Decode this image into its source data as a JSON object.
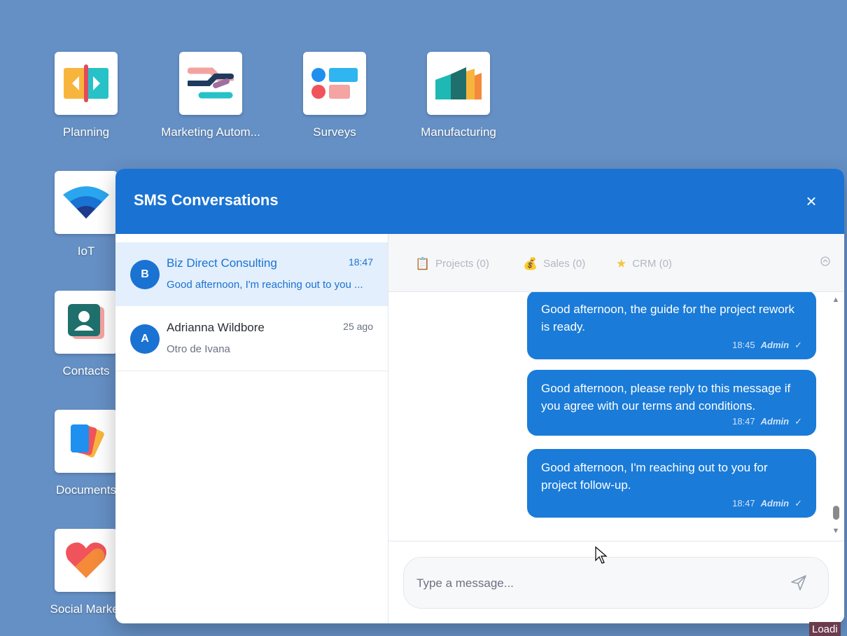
{
  "apps": [
    {
      "label": "Planning",
      "icon": "planning-icon"
    },
    {
      "label": "Marketing Autom...",
      "icon": "marketing-automation-icon"
    },
    {
      "label": "Surveys",
      "icon": "surveys-icon"
    },
    {
      "label": "Manufacturing",
      "icon": "manufacturing-icon"
    },
    {
      "label": "IoT",
      "icon": "iot-icon"
    },
    {
      "label": "Contacts",
      "icon": "contacts-icon"
    },
    {
      "label": "Documents",
      "icon": "documents-icon"
    },
    {
      "label": "Social Market",
      "icon": "social-marketing-icon"
    }
  ],
  "modal": {
    "title": "SMS Conversations",
    "close": "×"
  },
  "conversations": [
    {
      "avatar": "B",
      "name": "Biz Direct Consulting",
      "time": "18:47",
      "preview": "Good afternoon, I'm reaching out to you ...",
      "active": true
    },
    {
      "avatar": "A",
      "name": "Adrianna Wildbore",
      "time": "25 ago",
      "preview": "Otro de Ivana",
      "active": false
    }
  ],
  "tabs": [
    {
      "label": "Projects (0)",
      "icon": "clipboard-icon"
    },
    {
      "label": "Sales (0)",
      "icon": "money-bag-icon"
    },
    {
      "label": "CRM (0)",
      "icon": "star-icon"
    }
  ],
  "messages": [
    {
      "text": "Good afternoon, the guide for the project rework is ready.",
      "time": "18:45",
      "author": "Admin",
      "check": "✓"
    },
    {
      "text": "Good afternoon, please reply to this message if you agree with our terms and conditions.",
      "time": "18:47",
      "author": "Admin",
      "check": "✓"
    },
    {
      "text": "Good afternoon, I'm reaching out to you for project follow-up.",
      "time": "18:47",
      "author": "Admin",
      "check": "✓"
    }
  ],
  "composer": {
    "placeholder": "Type a message..."
  },
  "status": {
    "loading": "Loadi"
  },
  "colors": {
    "desktop_bg": "#6590c5",
    "accent": "#1a72d3",
    "bubble": "#1a7bd8"
  }
}
